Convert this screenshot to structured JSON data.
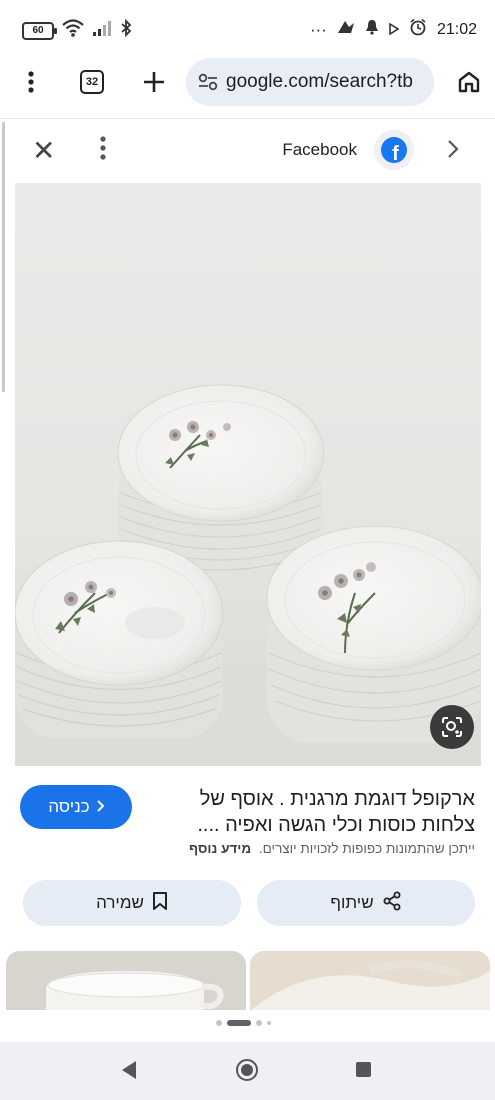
{
  "status_bar": {
    "battery": "60",
    "time": "21:02",
    "dots": "···"
  },
  "toolbar": {
    "tab_count": "32",
    "url": "google.com/search?tb"
  },
  "lens_header": {
    "source_label": "Facebook"
  },
  "result": {
    "title": "ארקופל דוגמת מרגנית . אוסף של צלחות כוסות וכלי הגשה ואפיה ....",
    "visit_label": "כניסה",
    "disclaimer": "ייתכן שהתמונות כפופות לזכויות יוצרים.",
    "more_info": "מידע נוסף"
  },
  "actions": {
    "share_label": "שיתוף",
    "save_label": "שמירה"
  },
  "colors": {
    "accent": "#1a73e8",
    "facebook": "#1877f2",
    "chip_bg": "#e6ecf6"
  }
}
